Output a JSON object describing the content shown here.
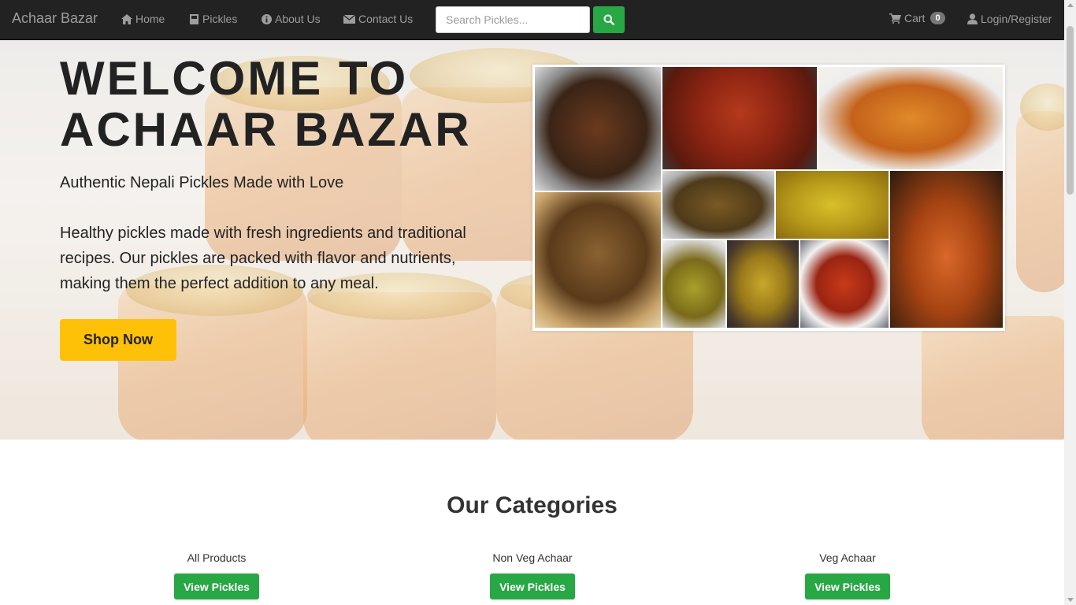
{
  "nav": {
    "brand": "Achaar Bazar",
    "home": "Home",
    "pickles": "Pickles",
    "about": "About Us",
    "contact": "Contact Us",
    "search_placeholder": "Search Pickles...",
    "cart": "Cart",
    "cart_count": "0",
    "login": "Login/Register"
  },
  "hero": {
    "title_line1": "WELCOME TO",
    "title_line2": "ACHAAR BAZAR",
    "subtitle": "Authentic Nepali Pickles Made with Love",
    "description": "Healthy pickles made with fresh ingredients and traditional recipes. Our pickles are packed with flavor and nutrients, making them the perfect addition to any meal.",
    "cta": "Shop Now"
  },
  "categories": {
    "heading": "Our Categories",
    "items": [
      {
        "name": "All Products",
        "button": "View Pickles"
      },
      {
        "name": "Non Veg Achaar",
        "button": "View Pickles"
      },
      {
        "name": "Veg Achaar",
        "button": "View Pickles"
      }
    ]
  },
  "colors": {
    "navbar": "#222222",
    "nav_text": "#9d9d9d",
    "accent_green": "#28a745",
    "cta_yellow": "#ffc107"
  }
}
